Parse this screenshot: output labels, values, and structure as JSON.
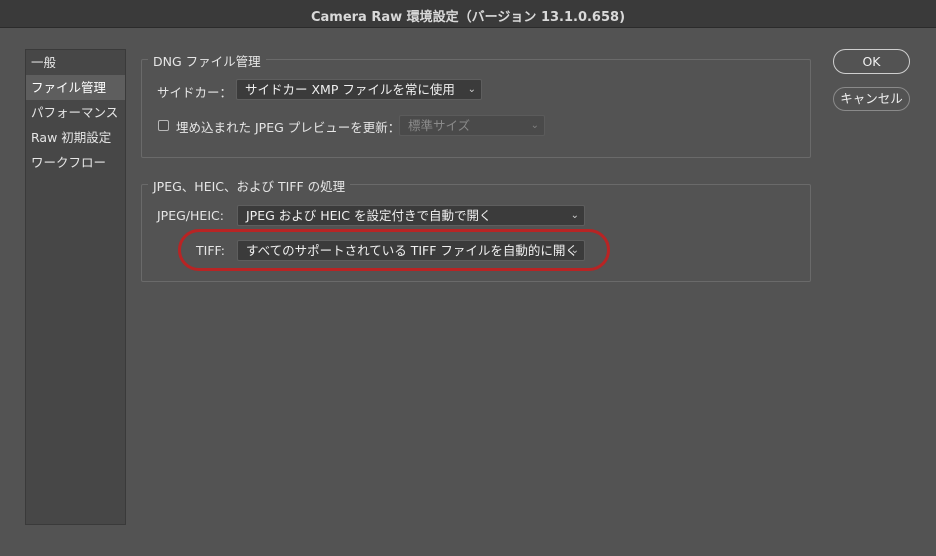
{
  "window": {
    "title": "Camera Raw 環境設定（バージョン 13.1.0.658)"
  },
  "sidebar": {
    "items": [
      {
        "label": "一般"
      },
      {
        "label": "ファイル管理",
        "selected": true
      },
      {
        "label": "パフォーマンス"
      },
      {
        "label": "Raw 初期設定"
      },
      {
        "label": "ワークフロー"
      }
    ]
  },
  "dng": {
    "title": "DNG ファイル管理",
    "sidecar_label": "サイドカー：",
    "sidecar_value": "サイドカー XMP ファイルを常に使用",
    "embed_checked": false,
    "embed_label": "埋め込まれた JPEG プレビューを更新：",
    "embed_value": "標準サイズ"
  },
  "jpeg": {
    "title": "JPEG、HEIC、および TIFF の処理",
    "jpeg_label": "JPEG/HEIC:",
    "jpeg_value": "JPEG および HEIC を設定付きで自動で開く",
    "tiff_label": "TIFF:",
    "tiff_value": "すべてのサポートされている TIFF ファイルを自動的に開く"
  },
  "buttons": {
    "ok": "OK",
    "cancel": "キャンセル"
  },
  "icons": {
    "dropdown": "chevron-down-icon",
    "dropdown_glyph": "⌄"
  },
  "colors": {
    "background": "#535353",
    "highlight_ring": "#b82424"
  }
}
